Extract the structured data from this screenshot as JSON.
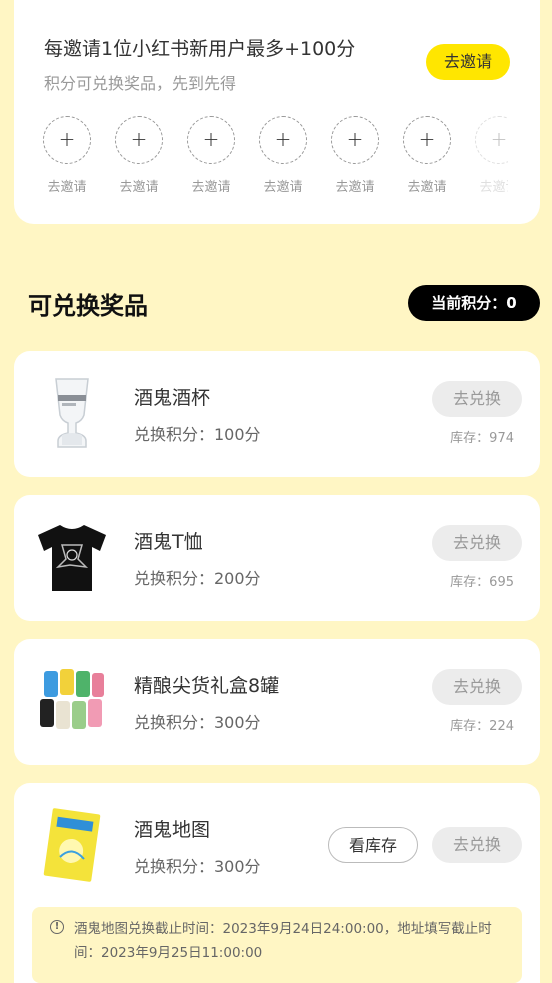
{
  "invite": {
    "title": "每邀请1位小红书新用户最多+100分",
    "subtitle": "积分可兑换奖品，先到先得",
    "button_label": "去邀请",
    "slots": [
      {
        "label": "去邀请",
        "icon": "plus-icon"
      },
      {
        "label": "去邀请",
        "icon": "plus-icon"
      },
      {
        "label": "去邀请",
        "icon": "plus-icon"
      },
      {
        "label": "去邀请",
        "icon": "plus-icon"
      },
      {
        "label": "去邀请",
        "icon": "plus-icon"
      },
      {
        "label": "去邀请",
        "icon": "plus-icon"
      },
      {
        "label": "去邀请",
        "icon": "plus-icon"
      }
    ]
  },
  "prizes_section": {
    "title": "可兑换奖品",
    "current_points_label": "当前积分：0"
  },
  "prizes": [
    {
      "name": "酒鬼酒杯",
      "points": "兑换积分：100分",
      "redeem_label": "去兑换",
      "stock": "库存：974",
      "image": "glass-cup-image"
    },
    {
      "name": "酒鬼T恤",
      "points": "兑换积分：200分",
      "redeem_label": "去兑换",
      "stock": "库存：695",
      "image": "black-tshirt-image"
    },
    {
      "name": "精酿尖货礼盒8罐",
      "points": "兑换积分：300分",
      "redeem_label": "去兑换",
      "stock": "库存：224",
      "image": "beer-cans-image"
    },
    {
      "name": "酒鬼地图",
      "points": "兑换积分：300分",
      "redeem_label": "去兑换",
      "check_stock_label": "看库存",
      "image": "map-book-image"
    }
  ],
  "notice": {
    "icon": "info-icon",
    "text": "酒鬼地图兑换截止时间：2023年9月24日24:00:00，地址填写截止时间：2023年9月25日11:00:00"
  },
  "colors": {
    "page_background": "#fff6c4",
    "accent_yellow": "#ffe600",
    "badge_black": "#000000",
    "disabled_gray": "#ececec"
  }
}
